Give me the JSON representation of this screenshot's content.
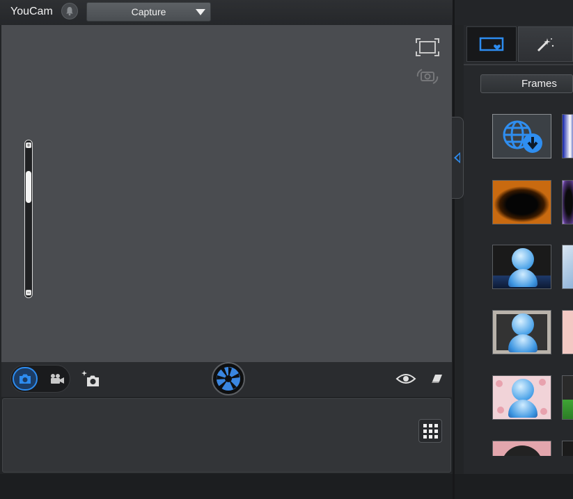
{
  "app": {
    "title": "YouCam",
    "mode_select": {
      "value": "Capture"
    }
  },
  "icons": {
    "notification": "bell-icon",
    "fullscreen": "fullscreen-icon",
    "switch_camera": "switch-camera-icon",
    "photo_mode": "camera-icon",
    "video_mode": "video-camera-icon",
    "effect_capture": "sparkle-camera-icon",
    "shutter": "shutter-aperture-icon",
    "face_detect": "eye-icon",
    "eraser": "eraser-icon",
    "grid_view": "grid-icon",
    "collapse": "chevron-left-icon",
    "frames_tab": "frame-heart-icon",
    "effects_tab": "magic-wand-icon",
    "download": "globe-download-icon"
  },
  "colors": {
    "accent": "#2d8cf0",
    "preview_bg": "#4a4c50",
    "panel_bg": "#26282b"
  },
  "zoom": {
    "level": 0.2
  },
  "right_panel": {
    "active_tab": "frames",
    "category": {
      "value": "Frames"
    }
  }
}
